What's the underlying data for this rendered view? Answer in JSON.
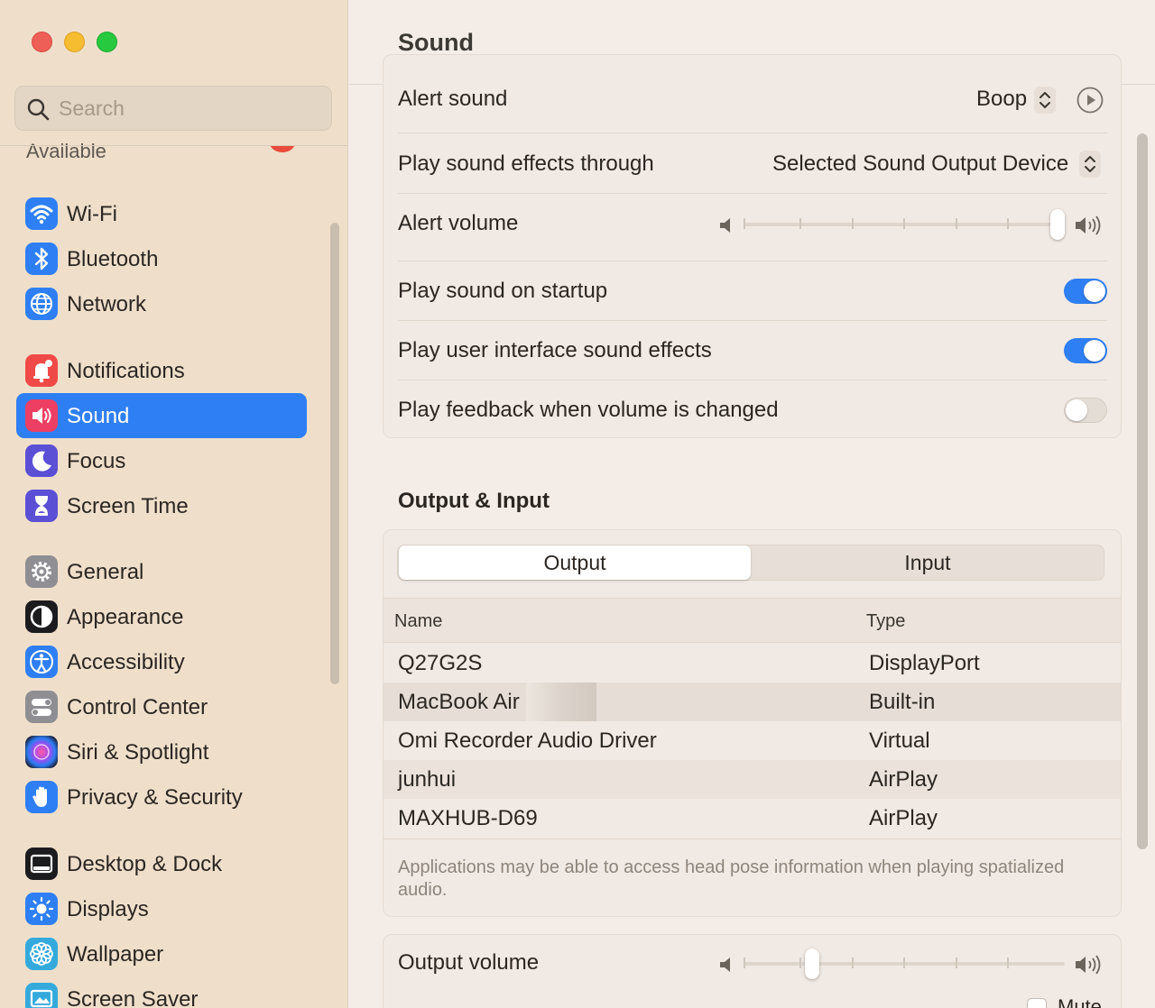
{
  "window": {
    "title": "Sound"
  },
  "sidebar": {
    "search_placeholder": "Search",
    "available_label": "Available",
    "groups": [
      {
        "items": [
          {
            "label": "Wi-Fi",
            "icon": "wifi-icon",
            "color": "#2e7ff3"
          },
          {
            "label": "Bluetooth",
            "icon": "bluetooth-icon",
            "color": "#2e7ff3"
          },
          {
            "label": "Network",
            "icon": "globe-icon",
            "color": "#2e7ff3"
          }
        ]
      },
      {
        "items": [
          {
            "label": "Notifications",
            "icon": "bell-icon",
            "color": "#ef4a47"
          },
          {
            "label": "Sound",
            "icon": "speaker-icon",
            "color": "#ec3f63",
            "selected": true
          },
          {
            "label": "Focus",
            "icon": "moon-icon",
            "color": "#5b4fd6"
          },
          {
            "label": "Screen Time",
            "icon": "hourglass-icon",
            "color": "#5b4fd6"
          }
        ]
      },
      {
        "items": [
          {
            "label": "General",
            "icon": "gear-icon",
            "color": "#8e8e93"
          },
          {
            "label": "Appearance",
            "icon": "appearance-icon",
            "color": "#1c1c1e"
          },
          {
            "label": "Accessibility",
            "icon": "accessibility-icon",
            "color": "#2e7ff3"
          },
          {
            "label": "Control Center",
            "icon": "switches-icon",
            "color": "#8e8e93"
          },
          {
            "label": "Siri & Spotlight",
            "icon": "siri-icon",
            "color": "#3b2b6e"
          },
          {
            "label": "Privacy & Security",
            "icon": "hand-icon",
            "color": "#2e7ff3"
          }
        ]
      },
      {
        "items": [
          {
            "label": "Desktop & Dock",
            "icon": "dock-icon",
            "color": "#1c1c1e"
          },
          {
            "label": "Displays",
            "icon": "sun-icon",
            "color": "#2e7ff3"
          },
          {
            "label": "Wallpaper",
            "icon": "flower-icon",
            "color": "#34aadc"
          },
          {
            "label": "Screen Saver",
            "icon": "screensaver-icon",
            "color": "#34aadc"
          }
        ]
      }
    ]
  },
  "sound": {
    "alert_sound": {
      "label": "Alert sound",
      "value": "Boop"
    },
    "play_through": {
      "label": "Play sound effects through",
      "value": "Selected Sound Output Device"
    },
    "alert_volume": {
      "label": "Alert volume",
      "level": 1.0
    },
    "startup": {
      "label": "Play sound on startup",
      "on": true
    },
    "ui_effects": {
      "label": "Play user interface sound effects",
      "on": true
    },
    "feedback": {
      "label": "Play feedback when volume is changed",
      "on": false
    }
  },
  "output_input": {
    "title": "Output & Input",
    "tabs": [
      "Output",
      "Input"
    ],
    "active_tab": "Output",
    "columns": {
      "name": "Name",
      "type": "Type"
    },
    "devices": [
      {
        "name": "Q27G2S",
        "type": "DisplayPort"
      },
      {
        "name": "MacBook Air",
        "type": "Built-in",
        "selected": true
      },
      {
        "name": "Omi Recorder Audio Driver",
        "type": "Virtual"
      },
      {
        "name": "junhui",
        "type": "AirPlay"
      },
      {
        "name": "MAXHUB-D69",
        "type": "AirPlay"
      }
    ],
    "footnote": "Applications may be able to access head pose information when playing spatialized audio."
  },
  "output_volume": {
    "label": "Output volume",
    "level": 0.2,
    "mute_label": "Mute",
    "muted": false
  },
  "colors": {
    "accent": "#2e7ff3",
    "sidebar_bg": "#efdfca",
    "content_bg": "#f4ede7"
  }
}
